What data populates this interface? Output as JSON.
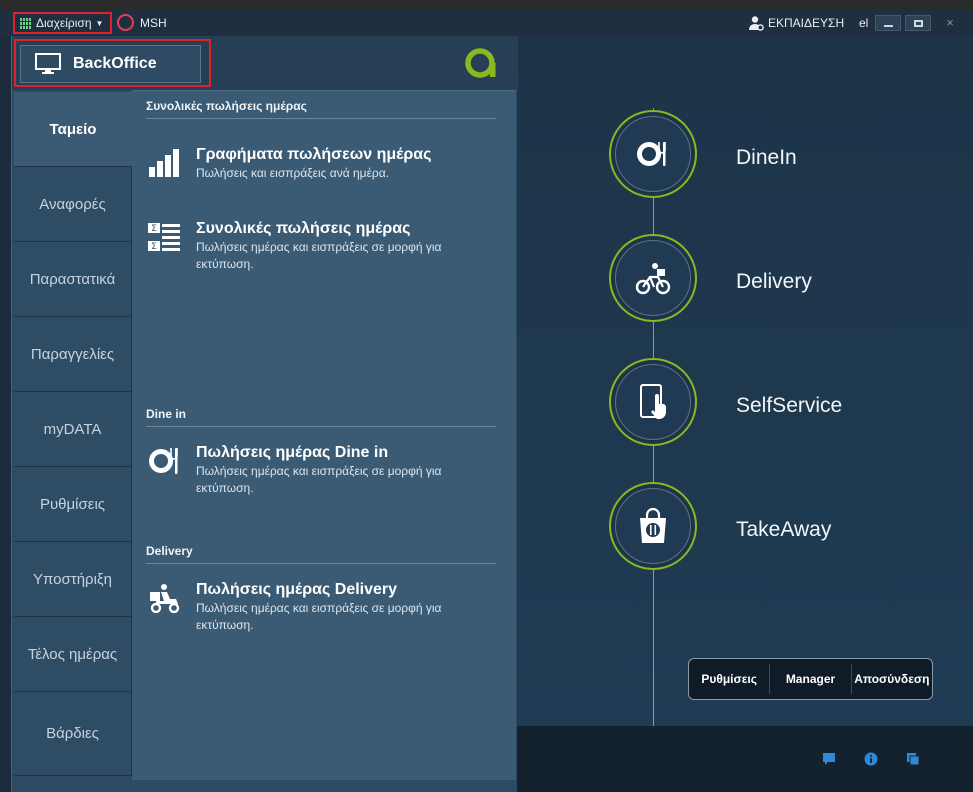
{
  "titlebar": {
    "menu_label": "Διαχείριση",
    "app_name": "MSH",
    "user": "ΕΚΠΑΙΔΕΥΣΗ",
    "lang": "el",
    "close_glyph": "×"
  },
  "backoffice": {
    "button_label": "BackOffice"
  },
  "sidebar": {
    "items": [
      {
        "label": "Ταμείο",
        "active": true
      },
      {
        "label": "Αναφορές"
      },
      {
        "label": "Παραστατικά"
      },
      {
        "label": "Παραγγελίες"
      },
      {
        "label": "myDATA"
      },
      {
        "label": "Ρυθμίσεις"
      },
      {
        "label": "Υποστήριξη"
      },
      {
        "label": "Τέλος ημέρας"
      },
      {
        "label": "Βάρδιες"
      }
    ]
  },
  "sections": [
    {
      "title": "Συνολικές πωλήσεις ημέρας",
      "items": [
        {
          "title": "Γραφήματα πωλήσεων ημέρας",
          "desc": "Πωλήσεις και εισπράξεις ανά ημέρα.",
          "icon": "bar-chart-icon"
        },
        {
          "title": "Συνολικές πωλήσεις ημέρας",
          "desc": "Πωλήσεις ημέρας και εισπράξεις σε μορφή για εκτύπωση.",
          "icon": "sum-list-icon"
        }
      ]
    },
    {
      "title": "Dine in",
      "items": [
        {
          "title": "Πωλήσεις ημέρας Dine in",
          "desc": "Πωλήσεις ημέρας και εισπράξεις σε μορφή για εκτύπωση.",
          "icon": "plate-cutlery-icon"
        }
      ]
    },
    {
      "title": "Delivery",
      "items": [
        {
          "title": "Πωλήσεις ημέρας Delivery",
          "desc": "Πωλήσεις ημέρας και εισπράξεις σε μορφή για εκτύπωση.",
          "icon": "scooter-icon"
        }
      ]
    }
  ],
  "channels": [
    {
      "label": "DineIn",
      "icon": "plate-cutlery-icon"
    },
    {
      "label": "Delivery",
      "icon": "bicycle-courier-icon"
    },
    {
      "label": "SelfService",
      "icon": "touch-tablet-icon"
    },
    {
      "label": "TakeAway",
      "icon": "takeaway-bag-icon"
    }
  ],
  "actions": {
    "settings": "Ρυθμίσεις",
    "manager": "Manager",
    "logout": "Αποσύνδεση"
  },
  "colors": {
    "accent_green": "#8ab820",
    "highlight_red": "#e0202a",
    "panel": "#3b5b74",
    "icon_blue": "#2e8ad8"
  }
}
